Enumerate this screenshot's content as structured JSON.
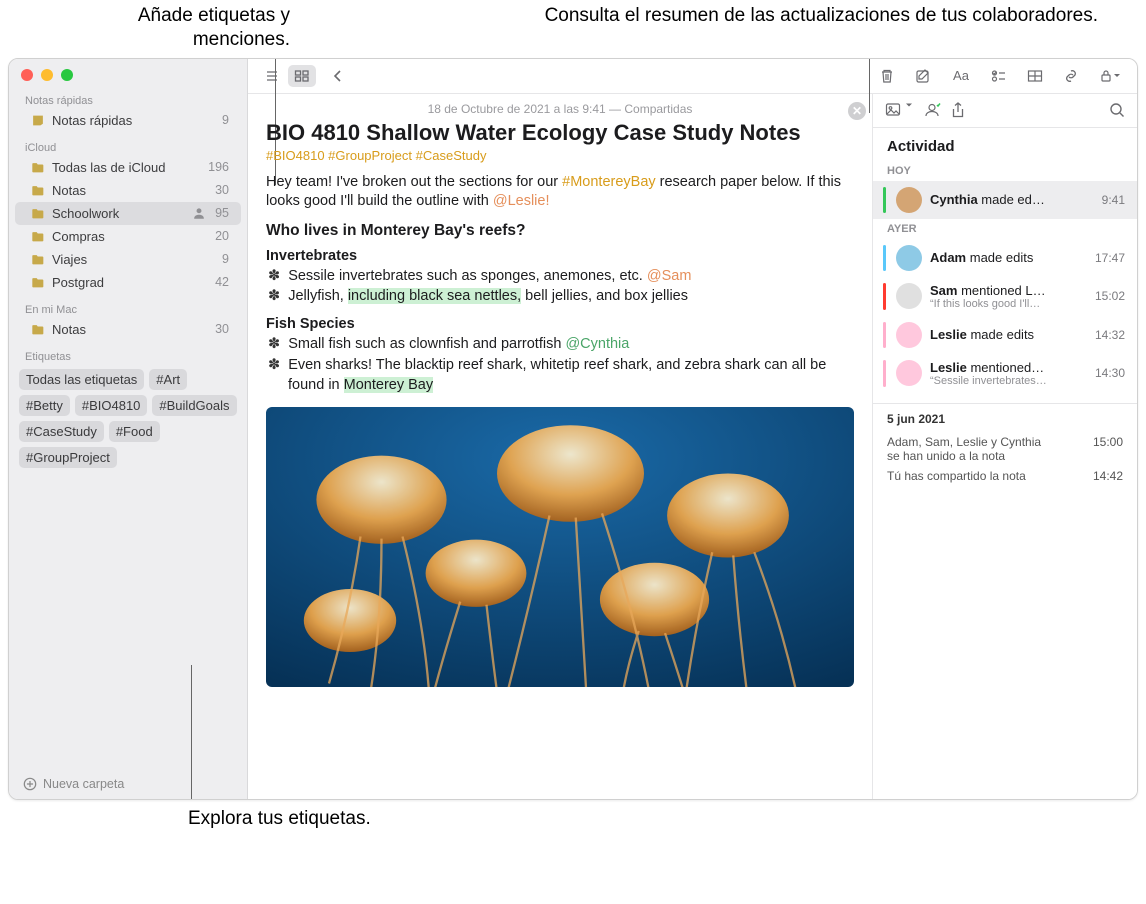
{
  "callouts": {
    "top_left": "Añade etiquetas y menciones.",
    "top_right": "Consulta el resumen de las actualizaciones de tus colaboradores.",
    "bottom": "Explora tus etiquetas."
  },
  "sidebar": {
    "quick_header": "Notas rápidas",
    "quick_item": {
      "label": "Notas rápidas",
      "count": "9"
    },
    "icloud_header": "iCloud",
    "icloud_items": [
      {
        "label": "Todas las de iCloud",
        "count": "196"
      },
      {
        "label": "Notas",
        "count": "30"
      },
      {
        "label": "Schoolwork",
        "count": "95",
        "shared": true,
        "selected": true
      },
      {
        "label": "Compras",
        "count": "20"
      },
      {
        "label": "Viajes",
        "count": "9"
      },
      {
        "label": "Postgrad",
        "count": "42"
      }
    ],
    "mac_header": "En mi Mac",
    "mac_items": [
      {
        "label": "Notas",
        "count": "30"
      }
    ],
    "tags_header": "Etiquetas",
    "tags": [
      "Todas las etiquetas",
      "#Art",
      "#Betty",
      "#BIO4810",
      "#BuildGoals",
      "#CaseStudy",
      "#Food",
      "#GroupProject"
    ],
    "new_folder": "Nueva carpeta"
  },
  "note": {
    "date": "18 de Octubre de 2021 a las 9:41 — Compartidas",
    "title": "BIO 4810 Shallow Water Ecology Case Study Notes",
    "tag1": "#BIO4810",
    "tag2": "#GroupProject",
    "tag3": "#CaseStudy",
    "p1a": "Hey team! I've broken out the sections for our ",
    "p1tag": "#MontereyBay",
    "p1b": " research paper below. If this looks good I'll build the outline with ",
    "p1m": "@Leslie!",
    "h2": "Who lives in Monterey Bay's reefs?",
    "inv_h": "Invertebrates",
    "inv1a": "Sessile invertebrates such as sponges, anemones, etc. ",
    "inv1m": "@Sam",
    "inv2a": "Jellyfish, ",
    "inv2hl": "including black sea nettles,",
    "inv2b": " bell jellies, and box jellies",
    "fish_h": "Fish Species",
    "fish1a": "Small fish such as clownfish and parrotfish ",
    "fish1m": "@Cynthia",
    "fish2a": "Even sharks! The blacktip reef shark, whitetip reef shark, and zebra shark can all be found in ",
    "fish2hl": "Monterey Bay"
  },
  "activity": {
    "title": "Actividad",
    "today": "HOY",
    "yesterday": "AYER",
    "items_today": [
      {
        "name": "Cynthia",
        "rest": " made ed…",
        "time": "9:41",
        "bar": "#34c759",
        "sel": true
      }
    ],
    "items_yesterday": [
      {
        "name": "Adam",
        "rest": " made edits",
        "time": "17:47",
        "bar": "#5ac8fa"
      },
      {
        "name": "Sam",
        "rest": " mentioned L…",
        "sub": "“If this looks good I'll…",
        "time": "15:02",
        "bar": "#ff3b30"
      },
      {
        "name": "Leslie",
        "rest": " made edits",
        "time": "14:32",
        "bar": "#ffafcc"
      },
      {
        "name": "Leslie",
        "rest": " mentioned…",
        "sub": "“Sessile invertebrates…",
        "time": "14:30",
        "bar": "#ffafcc"
      }
    ],
    "date_header": "5 jun 2021",
    "sys": [
      {
        "text": "Adam, Sam, Leslie y Cynthia se han unido a la nota",
        "time": "15:00"
      },
      {
        "text": "Tú has compartido la nota",
        "time": "14:42"
      }
    ]
  }
}
